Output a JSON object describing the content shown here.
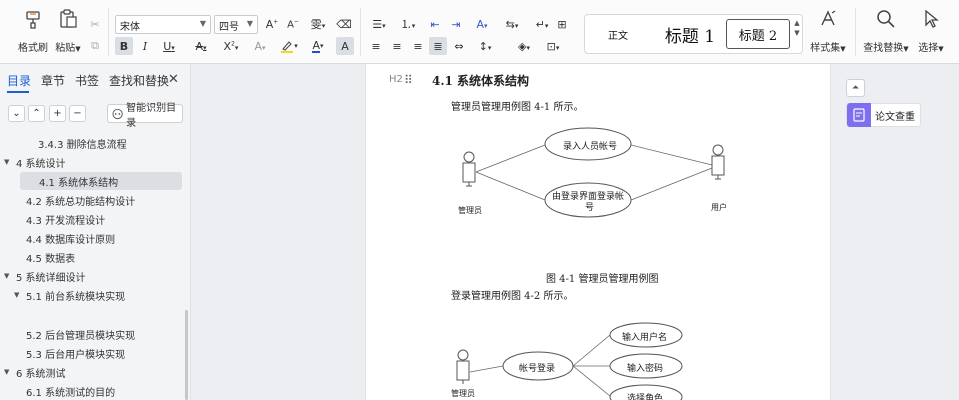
{
  "ribbon": {
    "format_painter": "格式刷",
    "paste": "粘贴",
    "font_name": "宋体",
    "font_size": "四号",
    "style_set": "样式集",
    "find_replace": "查找替换",
    "select": "选择"
  },
  "styles": {
    "normal": "正文",
    "heading1": "标题 1",
    "heading2": "标题 2"
  },
  "nav": {
    "tabs": [
      "目录",
      "章节",
      "书签",
      "查找和替换"
    ],
    "smart_toc": "智能识别目录",
    "items": [
      {
        "label": "3.4.3 删除信息流程",
        "level": 3,
        "arrow": ""
      },
      {
        "label": "4  系统设计",
        "level": 1,
        "arrow": "▼"
      },
      {
        "label": "4.1  系统体系结构",
        "level": 2,
        "arrow": ""
      },
      {
        "label": "4.2  系统总功能结构设计",
        "level": 2,
        "arrow": ""
      },
      {
        "label": "4.3 开发流程设计",
        "level": 2,
        "arrow": ""
      },
      {
        "label": "4.4  数据库设计原则",
        "level": 2,
        "arrow": ""
      },
      {
        "label": "4.5  数据表",
        "level": 2,
        "arrow": ""
      },
      {
        "label": "5  系统详细设计",
        "level": 1,
        "arrow": "▼"
      },
      {
        "label": "5.1 前台系统模块实现",
        "level": 2,
        "arrow": "▼"
      },
      {
        "label": "5.2 后台管理员模块实现",
        "level": 2,
        "arrow": ""
      },
      {
        "label": "5.3 后台用户模块实现",
        "level": 2,
        "arrow": ""
      },
      {
        "label": "6   系统测试",
        "level": 1,
        "arrow": "▼"
      },
      {
        "label": "6.1 系统测试的目的",
        "level": 2,
        "arrow": ""
      }
    ]
  },
  "doc": {
    "heading_marker": "H2",
    "heading": "4.1  系统体系结构",
    "para1": "管理员管理用例图 4-1 所示。",
    "caption1": "图 4-1  管理员管理用例图",
    "para2": "登录管理用例图 4-2 所示。",
    "diagram1": {
      "actor_left": "管理员",
      "actor_right": "用户",
      "usecase1": "录入人员帐号",
      "usecase2_line1": "由登录界面登录帐",
      "usecase2_line2": "号"
    },
    "diagram2": {
      "actor": "管理员",
      "center": "帐号登录",
      "uc1": "输入用户名",
      "uc2": "输入密码",
      "uc3": "选择角色"
    }
  },
  "right_panel": {
    "paper_check": "论文查重"
  }
}
